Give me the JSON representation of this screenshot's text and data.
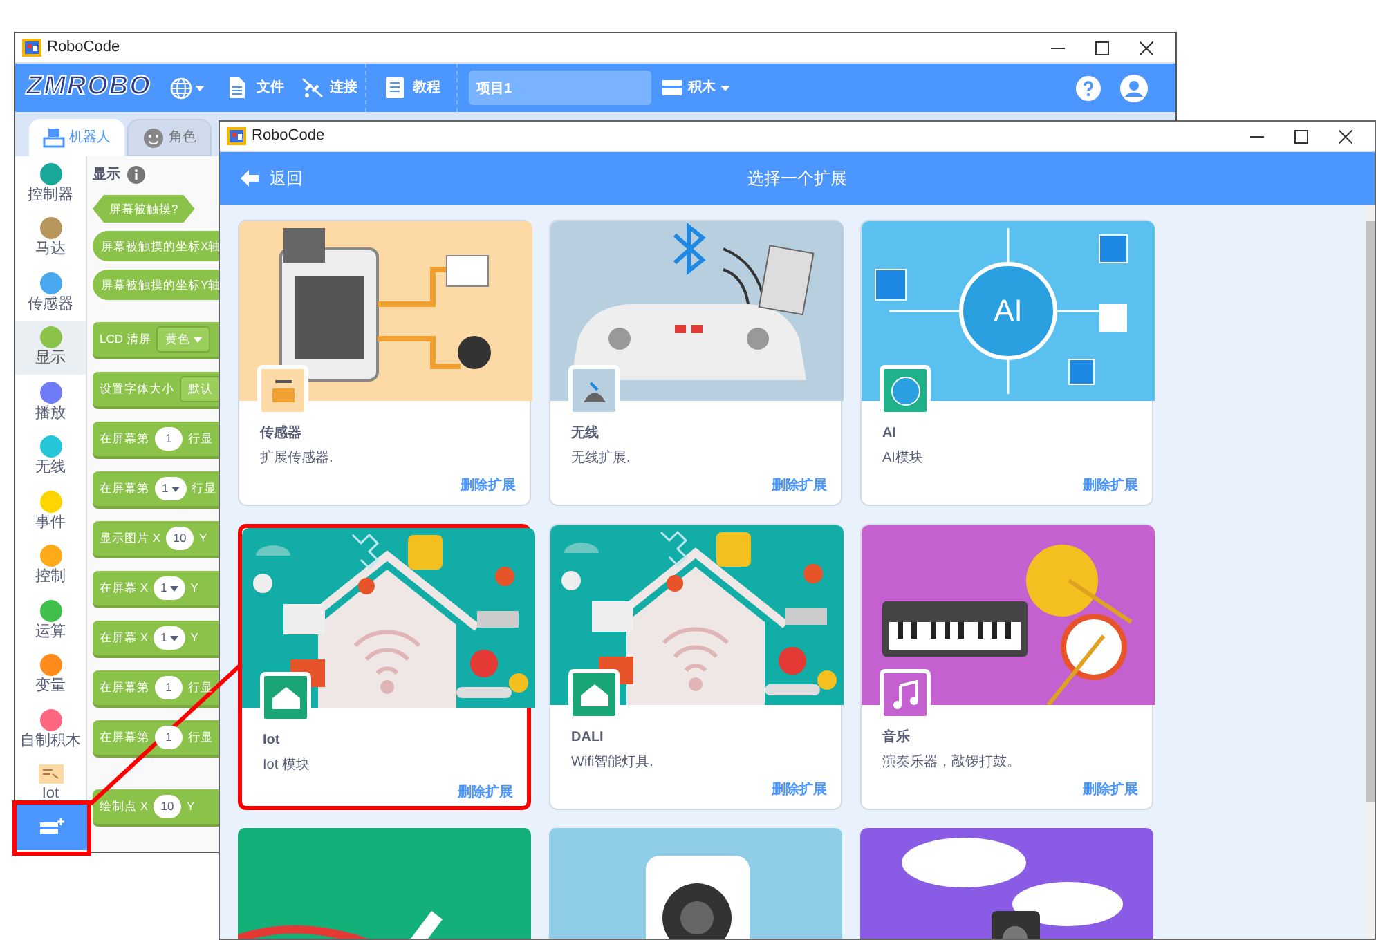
{
  "back_window": {
    "title": "RoboCode",
    "logo": "ZMROBO",
    "menus": [
      {
        "kind": "file",
        "label": "文件"
      },
      {
        "kind": "connect",
        "label": "连接"
      },
      {
        "kind": "tutorial",
        "label": "教程"
      }
    ],
    "project_name": "项目1",
    "blocks_menu": "积木",
    "tabs": [
      {
        "label": "机器人",
        "selected": true
      },
      {
        "label": "角色",
        "selected": false
      }
    ],
    "categories": [
      {
        "kind": "dot",
        "label": "控制器",
        "color": "#1aa89a",
        "selected": false
      },
      {
        "kind": "dot",
        "label": "马达",
        "color": "#b8955a",
        "selected": false
      },
      {
        "kind": "dot",
        "label": "传感器",
        "color": "#4aa8f0",
        "selected": false
      },
      {
        "kind": "dot",
        "label": "显示",
        "color": "#8bc34a",
        "selected": true
      },
      {
        "kind": "dot",
        "label": "播放",
        "color": "#6f7cf5",
        "selected": false
      },
      {
        "kind": "dot",
        "label": "无线",
        "color": "#26c6da",
        "selected": false
      },
      {
        "kind": "dot",
        "label": "事件",
        "color": "#ffd500",
        "selected": false
      },
      {
        "kind": "dot",
        "label": "控制",
        "color": "#ffab19",
        "selected": false
      },
      {
        "kind": "dot",
        "label": "运算",
        "color": "#40bf4a",
        "selected": false
      },
      {
        "kind": "dot",
        "label": "变量",
        "color": "#ff8c1a",
        "selected": false
      },
      {
        "kind": "dot",
        "label": "自制积木",
        "color": "#ff6680",
        "selected": false
      },
      {
        "kind": "extension",
        "label": "Iot",
        "selected": false
      }
    ],
    "palette_heading": "显示",
    "blocks": [
      {
        "kind": "boolean",
        "parts": [
          {
            "kind": "text",
            "text": "屏幕被触摸?"
          }
        ]
      },
      {
        "kind": "reporter",
        "parts": [
          {
            "kind": "text",
            "text": "屏幕被触摸的坐标X轴"
          }
        ]
      },
      {
        "kind": "reporter",
        "parts": [
          {
            "kind": "text",
            "text": "屏幕被触摸的坐标Y轴"
          }
        ]
      },
      {
        "kind": "command",
        "parts": [
          {
            "kind": "text",
            "text": "LCD 清屏"
          },
          {
            "kind": "menu",
            "text": "黄色"
          }
        ]
      },
      {
        "kind": "command",
        "parts": [
          {
            "kind": "text",
            "text": "设置字体大小"
          },
          {
            "kind": "menu_cut",
            "text": "默认"
          }
        ]
      },
      {
        "kind": "command",
        "parts": [
          {
            "kind": "text",
            "text": "在屏幕第"
          },
          {
            "kind": "number",
            "text": "1"
          },
          {
            "kind": "text",
            "text": "行显"
          }
        ]
      },
      {
        "kind": "command",
        "parts": [
          {
            "kind": "text",
            "text": "在屏幕第"
          },
          {
            "kind": "dropdown",
            "text": "1"
          },
          {
            "kind": "text",
            "text": "行显"
          }
        ]
      },
      {
        "kind": "command",
        "parts": [
          {
            "kind": "text",
            "text": "显示图片 X"
          },
          {
            "kind": "number",
            "text": "10"
          },
          {
            "kind": "text",
            "text": "Y"
          }
        ]
      },
      {
        "kind": "command",
        "parts": [
          {
            "kind": "text",
            "text": "在屏幕 X"
          },
          {
            "kind": "dropdown",
            "text": "1"
          },
          {
            "kind": "text",
            "text": "Y"
          }
        ]
      },
      {
        "kind": "command",
        "parts": [
          {
            "kind": "text",
            "text": "在屏幕 X"
          },
          {
            "kind": "dropdown",
            "text": "1"
          },
          {
            "kind": "text",
            "text": "Y"
          }
        ]
      },
      {
        "kind": "command",
        "parts": [
          {
            "kind": "text",
            "text": "在屏幕第"
          },
          {
            "kind": "number",
            "text": "1"
          },
          {
            "kind": "text",
            "text": "行显"
          }
        ]
      },
      {
        "kind": "command",
        "parts": [
          {
            "kind": "text",
            "text": "在屏幕第"
          },
          {
            "kind": "number",
            "text": "1"
          },
          {
            "kind": "text",
            "text": "行显"
          }
        ]
      },
      {
        "kind": "command_gap",
        "parts": [
          {
            "kind": "text",
            "text": "绘制点 X"
          },
          {
            "kind": "number",
            "text": "10"
          },
          {
            "kind": "text",
            "text": "Y"
          }
        ]
      }
    ],
    "extension_button": {
      "highlighted": true
    }
  },
  "front_window": {
    "title": "RoboCode",
    "back": "返回",
    "heading": "选择一个扩展",
    "extensions": [
      {
        "kind": "sensor",
        "title": "传感器",
        "description": "扩展传感器.",
        "action": "删除扩展",
        "highlighted": false
      },
      {
        "kind": "wireless",
        "title": "无线",
        "description": "无线扩展.",
        "action": "删除扩展",
        "highlighted": false
      },
      {
        "kind": "ai",
        "art_label": "AI",
        "title": "AI",
        "description": "AI模块",
        "action": "删除扩展",
        "highlighted": false
      },
      {
        "kind": "iot",
        "title": "Iot",
        "description": "Iot 模块",
        "action": "删除扩展",
        "highlighted": true
      },
      {
        "kind": "iot",
        "title": "DALI",
        "description": "Wifi智能灯具.",
        "action": "删除扩展",
        "highlighted": false
      },
      {
        "kind": "music",
        "title": "音乐",
        "description": "演奏乐器，敲锣打鼓。",
        "action": "删除扩展",
        "highlighted": false
      },
      {
        "kind": "pen"
      },
      {
        "kind": "camera"
      },
      {
        "kind": "speech"
      }
    ]
  }
}
